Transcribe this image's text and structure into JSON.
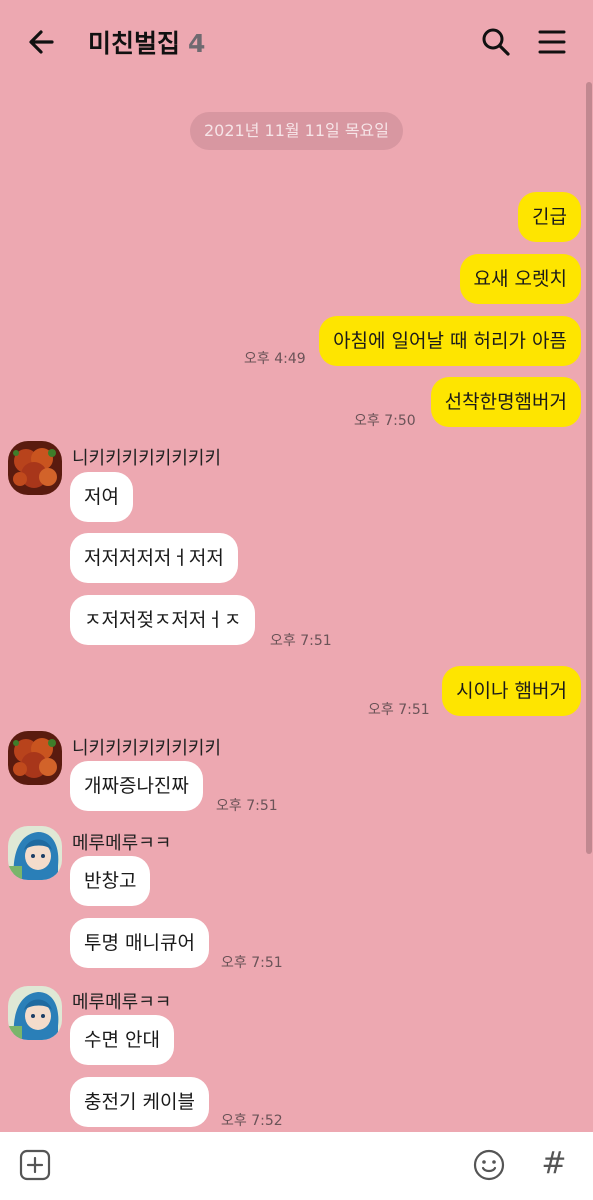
{
  "header": {
    "title": "미친벌집",
    "member_count": "4"
  },
  "date_separator": "2021년 11월 11일 목요일",
  "messages": [
    {
      "text": "긴급"
    },
    {
      "text": "요새 오렛치"
    },
    {
      "text": "아침에 일어날 때 허리가 아픔",
      "time": "오후 4:49"
    },
    {
      "text": "선착한명햄버거",
      "time": "오후 7:50"
    },
    {
      "sender": "니키키키키키키키키",
      "text": "저여"
    },
    {
      "text": "저저저저저ㅓ저저"
    },
    {
      "text": "ㅈ저저젖ㅈ저저ㅓㅈ",
      "time": "오후 7:51"
    },
    {
      "text": "시이나 햄버거",
      "time": "오후 7:51"
    },
    {
      "sender": "니키키키키키키키키",
      "text": "개짜증나진짜",
      "time": "오후 7:51"
    },
    {
      "sender": "메루메루ㅋㅋ",
      "text": "반창고"
    },
    {
      "text": "투명 매니큐어",
      "time": "오후 7:51"
    },
    {
      "sender": "메루메루ㅋㅋ",
      "text": "수면 안대"
    },
    {
      "text": "충전기 케이블",
      "time": "오후 7:52"
    }
  ],
  "colors": {
    "background": "#EDA8B1",
    "my_bubble": "#FEE500",
    "their_bubble": "#FFFFFF"
  },
  "icons": {
    "back": "arrow-left-icon",
    "search": "search-icon",
    "menu": "hamburger-menu-icon",
    "plus": "plus-square-icon",
    "emoji": "smiley-icon",
    "hash": "#"
  }
}
